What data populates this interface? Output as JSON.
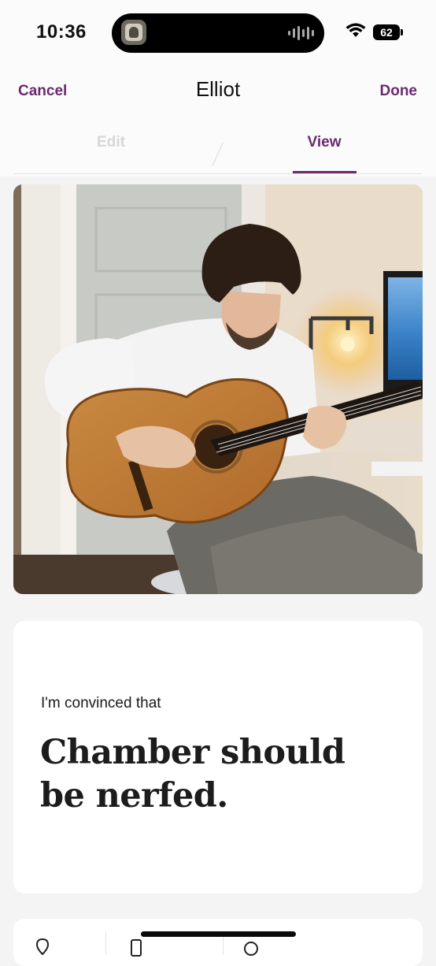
{
  "status_bar": {
    "time": "10:36",
    "battery": "62",
    "icons": [
      "now-playing-artwork-icon",
      "audio-waveform-icon",
      "wifi-icon",
      "battery-icon"
    ]
  },
  "header": {
    "cancel_label": "Cancel",
    "title": "Elliot",
    "done_label": "Done"
  },
  "tabs": [
    {
      "label": "Edit",
      "selected": false
    },
    {
      "label": "View",
      "selected": true
    }
  ],
  "photo": {
    "description": "Man in white long-sleeve shirt playing a classical guitar"
  },
  "prompt": {
    "label": "I'm convinced that",
    "answer": "Chamber should be nerfed."
  },
  "colors": {
    "accent": "#6b2a6f",
    "background": "#f4f4f4",
    "card": "#ffffff",
    "tab_inactive": "#d6d6d6"
  },
  "bottom_card": {
    "icons": [
      "location-pin-icon",
      "phone-icon",
      "globe-icon"
    ]
  }
}
